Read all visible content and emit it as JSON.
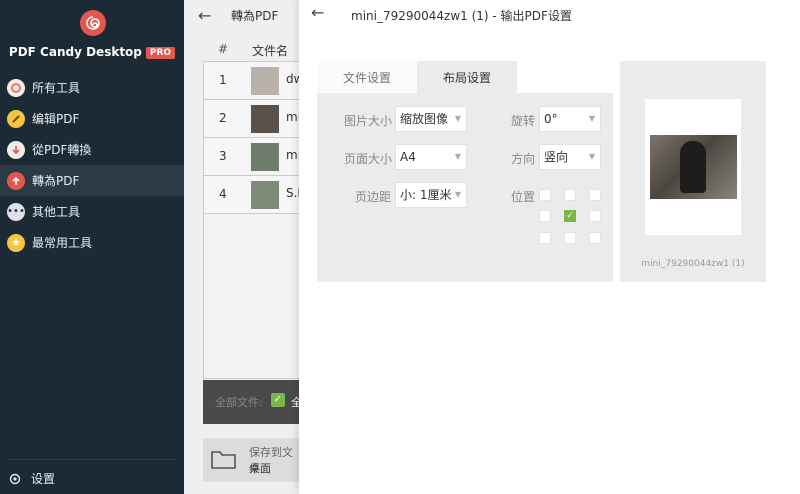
{
  "app": {
    "brand": "PDF Candy Desktop",
    "pro_badge": "PRO"
  },
  "sidebar": {
    "items": [
      {
        "label": "所有工具",
        "icon": "spiral-icon"
      },
      {
        "label": "编辑PDF",
        "icon": "pencil-icon"
      },
      {
        "label": "從PDF轉換",
        "icon": "arrow-down-icon"
      },
      {
        "label": "轉為PDF",
        "icon": "arrow-up-icon",
        "active": true
      },
      {
        "label": "其他工具",
        "icon": "dots-icon"
      },
      {
        "label": "最常用工具",
        "icon": "star-icon"
      }
    ],
    "settings_label": "设置"
  },
  "background": {
    "title": "轉為PDF",
    "col_hash": "#",
    "col_name": "文件名",
    "rows": [
      {
        "num": "1",
        "name": "dw"
      },
      {
        "num": "2",
        "name": "mi"
      },
      {
        "num": "3",
        "name": "mi"
      },
      {
        "num": "4",
        "name": "S.F"
      }
    ],
    "all_files_label": "全部文件:",
    "all_files_cut": "全",
    "save_to_label": "保存到文件",
    "save_location": "桌面"
  },
  "panel": {
    "title": "mini_79290044zw1 (1) - 输出PDF设置",
    "tabs": [
      "文件设置",
      "布局设置"
    ],
    "active_tab": 1,
    "fields": {
      "image_size_label": "图片大小",
      "image_size_value": "缩放图像",
      "page_size_label": "页面大小",
      "page_size_value": "A4",
      "margin_label": "页边距",
      "margin_value": "小: 1厘米",
      "rotation_label": "旋转",
      "rotation_value": "0°",
      "orientation_label": "方向",
      "orientation_value": "竖向",
      "position_label": "位置"
    },
    "position_grid": [
      [
        false,
        false,
        false
      ],
      [
        false,
        true,
        false
      ],
      [
        false,
        false,
        false
      ]
    ],
    "preview_filename": "mini_79290044zw1 (1)"
  },
  "colors": {
    "sidebar_bg": "#1c2a35",
    "accent_red": "#e4574f",
    "check_green": "#7ab648"
  }
}
